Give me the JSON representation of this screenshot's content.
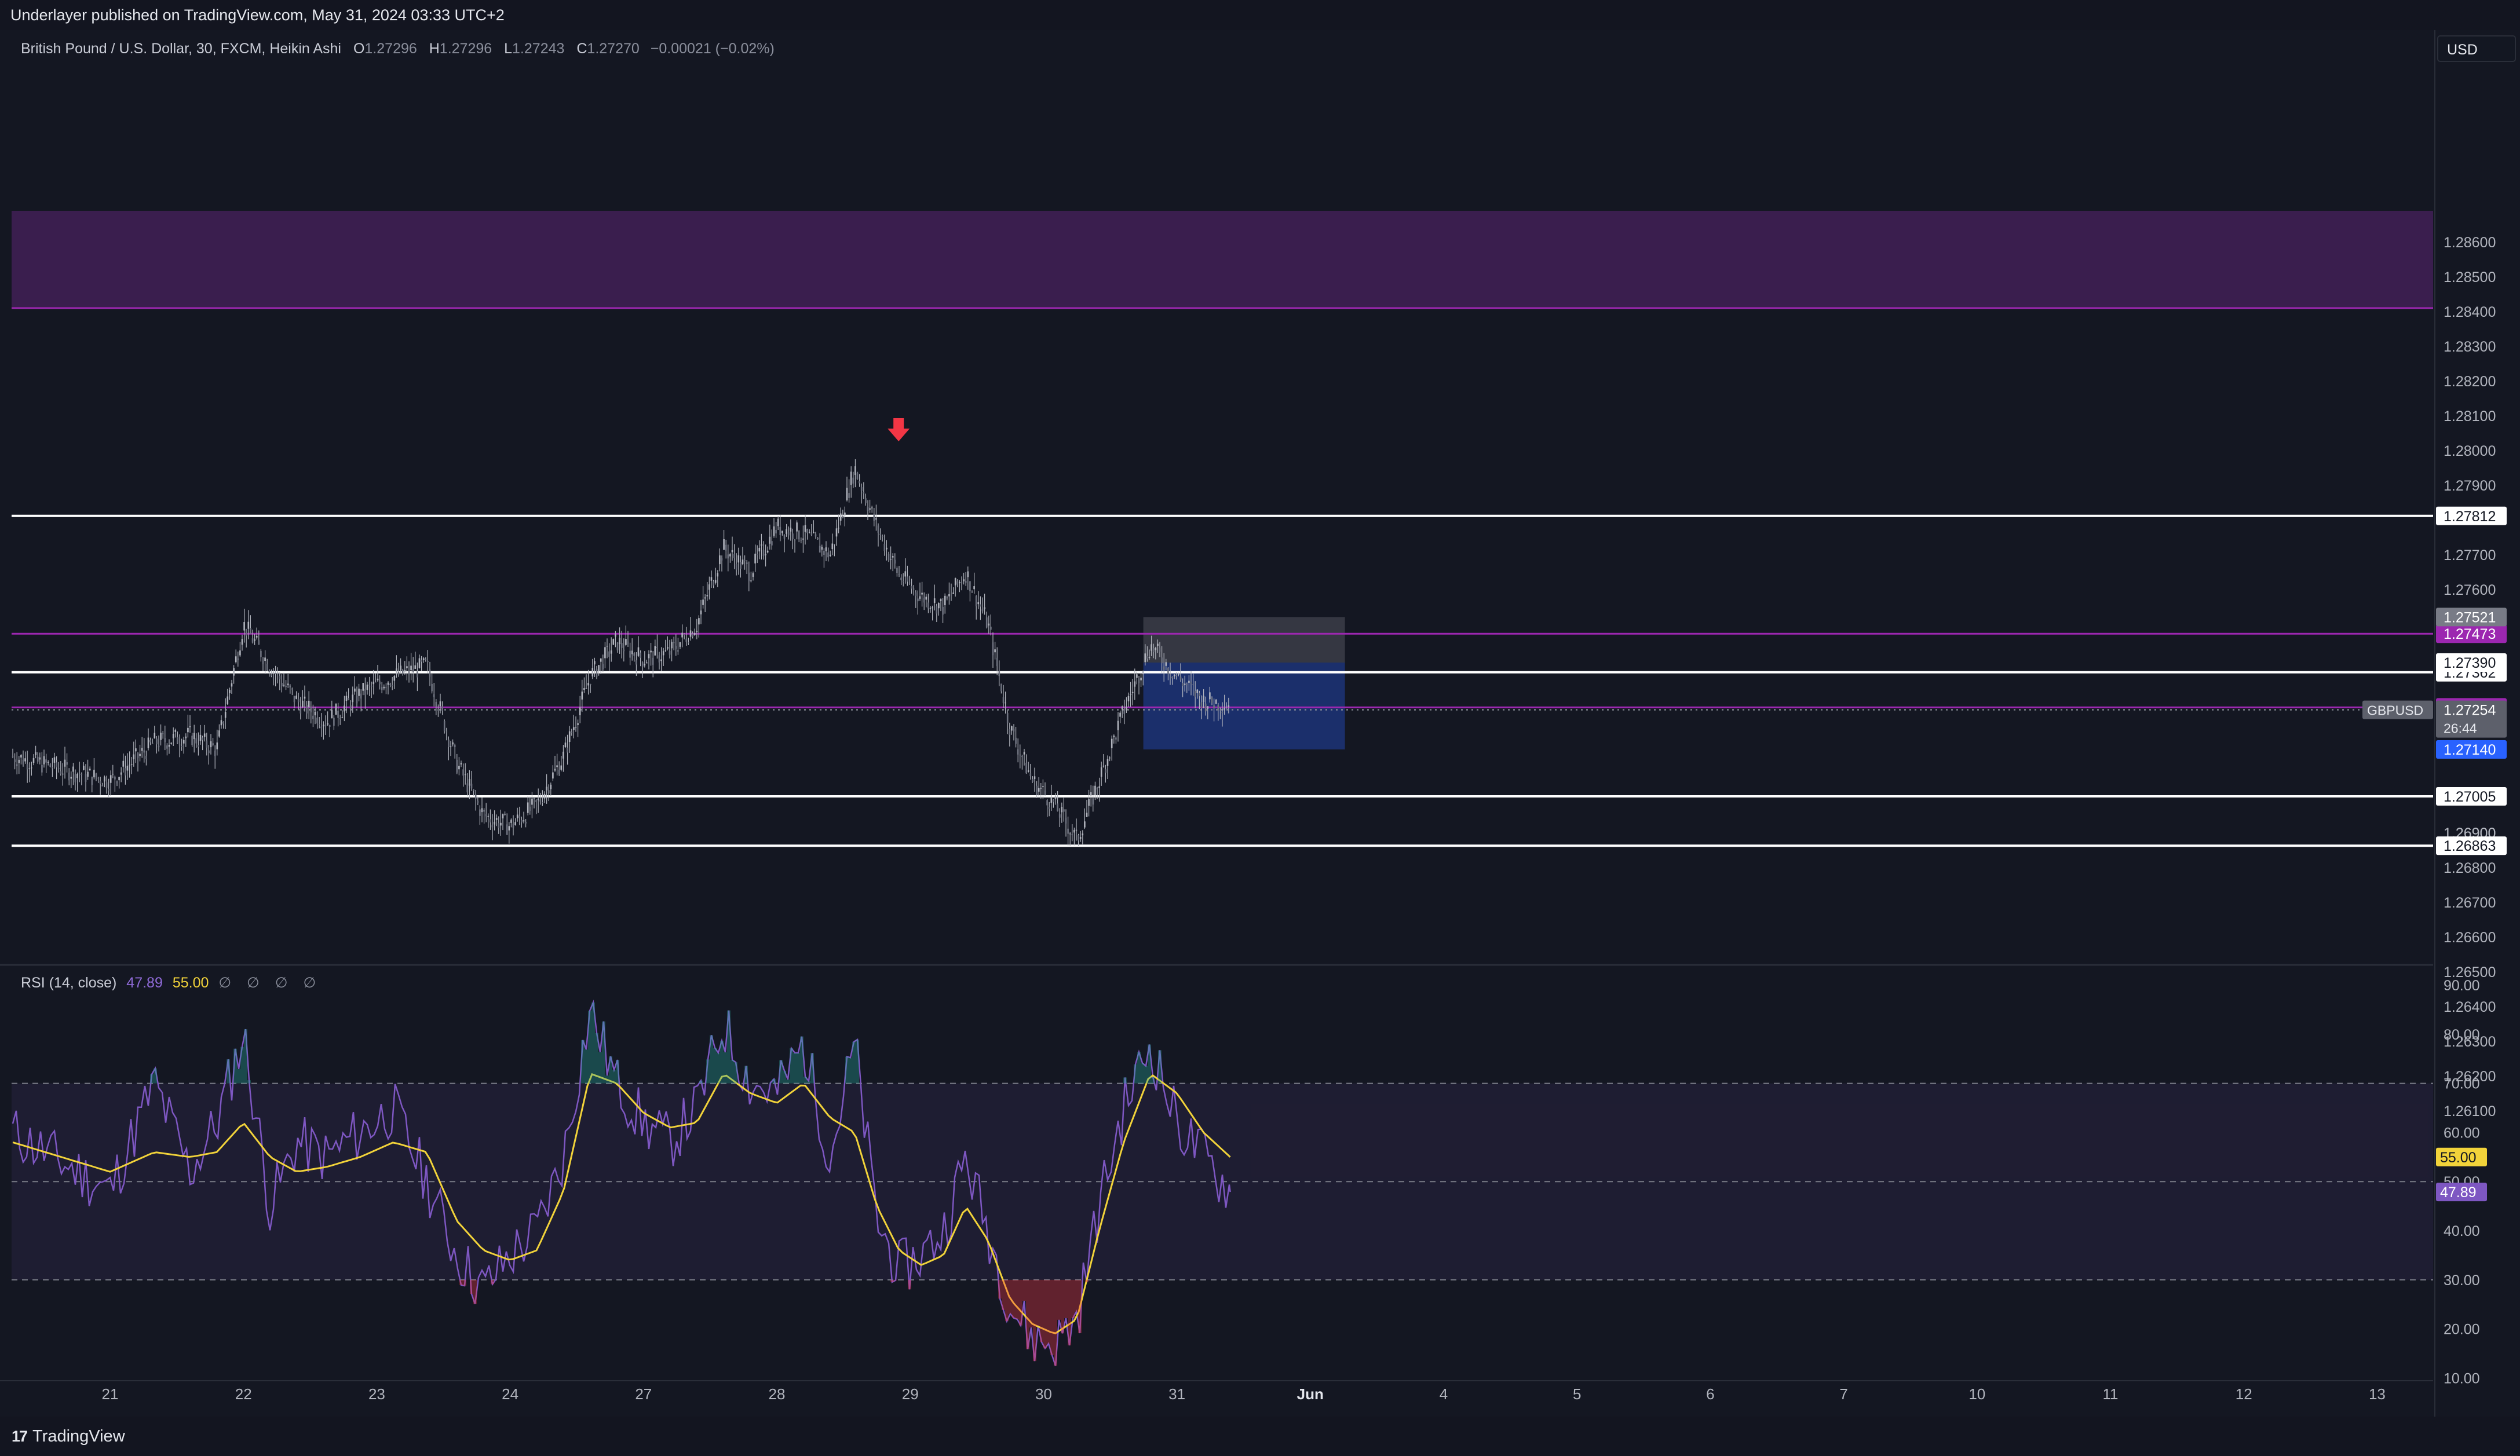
{
  "header": {
    "published": "Underlayer published on TradingView.com, May 31, 2024 03:33 UTC+2"
  },
  "legend": {
    "symbol": "British Pound / U.S. Dollar, 30, FXCM, Heikin Ashi",
    "o_label": "O",
    "o_value": "1.27296",
    "h_label": "H",
    "h_value": "1.27296",
    "l_label": "L",
    "l_value": "1.27243",
    "c_label": "C",
    "c_value": "1.27270",
    "change": "−0.00021 (−0.02%)"
  },
  "rsi_legend": {
    "name": "RSI (14, close)",
    "rsi_value": "47.89",
    "ma_value": "55.00",
    "extras": "∅ ∅ ∅ ∅"
  },
  "footer": {
    "brand": "TradingView"
  },
  "colors": {
    "background": "#141722",
    "candle": "#b2b5be",
    "white_line": "#ffffff",
    "purple_line": "#9c27b0",
    "purple_zone": "#3a1e4e",
    "rsi_line": "#7e57c2",
    "rsi_ma": "#f2d33a",
    "position_stop": "#5d606b",
    "position_target": "#1e3a8a",
    "down_arrow": "#f23645"
  },
  "chart_data": [
    {
      "type": "candlestick",
      "style": "Heikin Ashi",
      "symbol": "GBPUSD",
      "currency": "USD",
      "yaxis_ticks": [
        1.286,
        1.285,
        1.284,
        1.283,
        1.282,
        1.281,
        1.28,
        1.279,
        1.277,
        1.276,
        1.269,
        1.268,
        1.267,
        1.266,
        1.265,
        1.264,
        1.263,
        1.262,
        1.261
      ],
      "ylim": [
        1.2605,
        1.2869
      ],
      "x_ticks": [
        "21",
        "22",
        "23",
        "24",
        "27",
        "28",
        "29",
        "30",
        "31",
        "Jun",
        "4",
        "5",
        "6",
        "7",
        "10",
        "11",
        "12",
        "13"
      ],
      "price_path": [
        [
          "21",
          1.2712
        ],
        [
          "21",
          1.2705
        ],
        [
          "21",
          1.2716
        ],
        [
          "22",
          1.2718
        ],
        [
          "22",
          1.2714
        ],
        [
          "22",
          1.275
        ],
        [
          "22",
          1.2738
        ],
        [
          "22",
          1.2728
        ],
        [
          "23",
          1.2722
        ],
        [
          "23",
          1.273
        ],
        [
          "23",
          1.2735
        ],
        [
          "23",
          1.2738
        ],
        [
          "24",
          1.271
        ],
        [
          "24",
          1.2695
        ],
        [
          "24",
          1.2692
        ],
        [
          "24",
          1.2698
        ],
        [
          "24",
          1.2712
        ],
        [
          "27",
          1.2735
        ],
        [
          "27",
          1.2745
        ],
        [
          "27",
          1.274
        ],
        [
          "27",
          1.2742
        ],
        [
          "27",
          1.275
        ],
        [
          "28",
          1.2772
        ],
        [
          "28",
          1.2765
        ],
        [
          "28",
          1.2778
        ],
        [
          "28",
          1.2776
        ],
        [
          "28",
          1.277
        ],
        [
          "29",
          1.2795
        ],
        [
          "29",
          1.2778
        ],
        [
          "29",
          1.2764
        ],
        [
          "29",
          1.2758
        ],
        [
          "29",
          1.2755
        ],
        [
          "29",
          1.2765
        ],
        [
          "30",
          1.275
        ],
        [
          "30",
          1.272
        ],
        [
          "30",
          1.2705
        ],
        [
          "30",
          1.2698
        ],
        [
          "30",
          1.2688
        ],
        [
          "30",
          1.2705
        ],
        [
          "31",
          1.2725
        ],
        [
          "31",
          1.2744
        ],
        [
          "31",
          1.2735
        ],
        [
          "31",
          1.2728
        ],
        [
          "31",
          1.2727
        ]
      ],
      "horizontal_lines": [
        {
          "price": 1.27812,
          "label": "1.27812",
          "style": "white"
        },
        {
          "price": 1.27362,
          "label": "1.27362",
          "style": "white"
        },
        {
          "price": 1.27005,
          "label": "1.27005",
          "style": "white"
        },
        {
          "price": 1.26863,
          "label": "1.26863",
          "style": "white"
        },
        {
          "price": 1.27473,
          "label": "1.27473",
          "style": "purple"
        },
        {
          "price": 1.27261,
          "label": "1.27261",
          "style": "purple"
        }
      ],
      "supply_zone": {
        "from": 1.2841,
        "to": 1.2869
      },
      "position": {
        "stop": "1.27521",
        "entry": "1.27390",
        "target_top": "1.27249",
        "target": "1.27140"
      },
      "last_price": {
        "symbol": "GBPUSD",
        "price": "1.27254",
        "countdown": "26:44"
      },
      "hidden_tick_label": "1.26900",
      "annotation": {
        "type": "down-arrow",
        "near": "29",
        "price": 1.2801
      }
    },
    {
      "type": "line",
      "name": "RSI (14, close)",
      "ylim": [
        10,
        90
      ],
      "yaxis_ticks": [
        90,
        80,
        70,
        60,
        50,
        40,
        30,
        20,
        10
      ],
      "ytick_labels": [
        "90.00",
        "80.00",
        "70.00",
        "60.00",
        "50.00",
        "40.00",
        "30.00",
        "20.00",
        "10.00"
      ],
      "bands": [
        30,
        50,
        70
      ],
      "series": [
        {
          "name": "RSI",
          "last": "47.89",
          "points": [
            [
              "21",
              60
            ],
            [
              "21",
              48
            ],
            [
              "21",
              70
            ],
            [
              "22",
              52
            ],
            [
              "22",
              62
            ],
            [
              "22",
              80
            ],
            [
              "22",
              45
            ],
            [
              "22",
              58
            ],
            [
              "23",
              55
            ],
            [
              "23",
              60
            ],
            [
              "23",
              65
            ],
            [
              "23",
              50
            ],
            [
              "24",
              35
            ],
            [
              "24",
              28
            ],
            [
              "24",
              35
            ],
            [
              "24",
              40
            ],
            [
              "24",
              55
            ],
            [
              "27",
              85
            ],
            [
              "27",
              70
            ],
            [
              "27",
              62
            ],
            [
              "27",
              58
            ],
            [
              "27",
              65
            ],
            [
              "28",
              82
            ],
            [
              "28",
              70
            ],
            [
              "28",
              68
            ],
            [
              "28",
              78
            ],
            [
              "28",
              55
            ],
            [
              "29",
              78
            ],
            [
              "29",
              42
            ],
            [
              "29",
              32
            ],
            [
              "29",
              35
            ],
            [
              "29",
              40
            ],
            [
              "29",
              55
            ],
            [
              "30",
              40
            ],
            [
              "30",
              25
            ],
            [
              "30",
              18
            ],
            [
              "30",
              17
            ],
            [
              "30",
              22
            ],
            [
              "30",
              45
            ],
            [
              "31",
              65
            ],
            [
              "31",
              78
            ],
            [
              "31",
              62
            ],
            [
              "31",
              55
            ],
            [
              "31",
              47.89
            ]
          ]
        },
        {
          "name": "RSI-based MA",
          "last": "55.00",
          "points": [
            [
              "21",
              58
            ],
            [
              "21",
              52
            ],
            [
              "21",
              56
            ],
            [
              "22",
              55
            ],
            [
              "22",
              56
            ],
            [
              "22",
              62
            ],
            [
              "22",
              55
            ],
            [
              "22",
              52
            ],
            [
              "23",
              53
            ],
            [
              "23",
              55
            ],
            [
              "23",
              58
            ],
            [
              "23",
              56
            ],
            [
              "24",
              42
            ],
            [
              "24",
              36
            ],
            [
              "24",
              34
            ],
            [
              "24",
              36
            ],
            [
              "24",
              48
            ],
            [
              "27",
              72
            ],
            [
              "27",
              70
            ],
            [
              "27",
              64
            ],
            [
              "27",
              61
            ],
            [
              "27",
              62
            ],
            [
              "28",
              72
            ],
            [
              "28",
              68
            ],
            [
              "28",
              66
            ],
            [
              "28",
              70
            ],
            [
              "28",
              63
            ],
            [
              "29",
              60
            ],
            [
              "29",
              45
            ],
            [
              "29",
              36
            ],
            [
              "29",
              33
            ],
            [
              "29",
              35
            ],
            [
              "29",
              45
            ],
            [
              "30",
              38
            ],
            [
              "30",
              26
            ],
            [
              "30",
              21
            ],
            [
              "30",
              19
            ],
            [
              "30",
              22
            ],
            [
              "30",
              40
            ],
            [
              "31",
              58
            ],
            [
              "31",
              72
            ],
            [
              "31",
              68
            ],
            [
              "31",
              60
            ],
            [
              "31",
              55
            ]
          ]
        }
      ]
    }
  ]
}
